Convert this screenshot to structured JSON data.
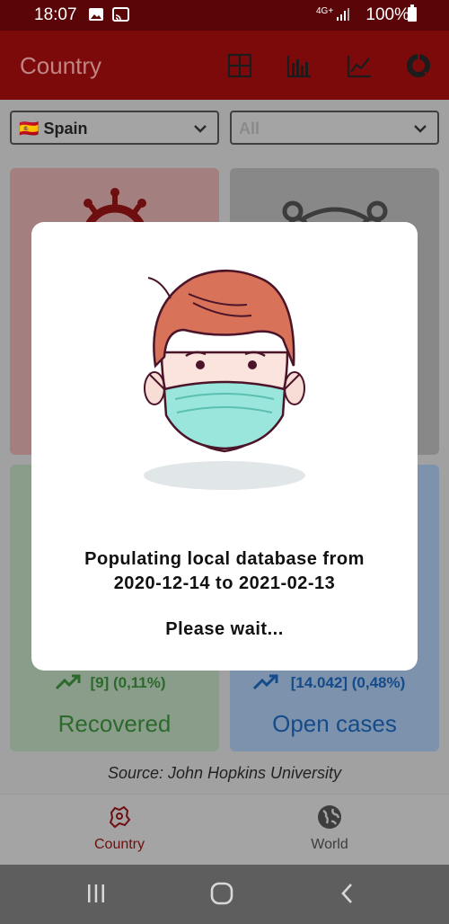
{
  "status_bar": {
    "time": "18:07",
    "network": "4G+",
    "battery": "100%"
  },
  "app_bar": {
    "title": "Country"
  },
  "filters": {
    "country": "Spain",
    "flag": "🇪🇸",
    "region": "All"
  },
  "cards": {
    "recovered": {
      "stat": "[9] (0,11%)",
      "label": "Recovered"
    },
    "open_cases": {
      "stat": "[14.042] (0,48%)",
      "label": "Open cases"
    }
  },
  "source": "Source: John Hopkins University",
  "bottom_nav": {
    "country": "Country",
    "world": "World"
  },
  "dialog": {
    "line1": "Populating local database from",
    "line2": "2020-12-14 to 2021-02-13",
    "wait": "Please wait..."
  },
  "colors": {
    "primary": "#7d0a0b",
    "status_bar": "#5a0507",
    "recovered": "#2c6a2c",
    "open_cases": "#154b8a"
  }
}
